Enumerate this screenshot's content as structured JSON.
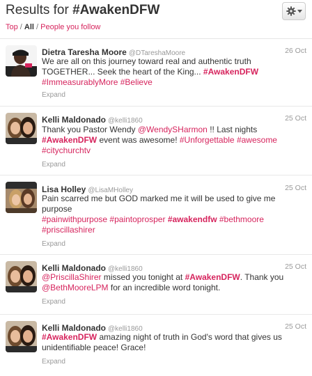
{
  "header": {
    "title_prefix": "Results for ",
    "title_query": "#AwakenDFW",
    "filters": {
      "top": "Top",
      "sep1": " / ",
      "all": "All",
      "sep2": " / ",
      "people": "People you follow"
    }
  },
  "colors": {
    "accent": "#d6245d",
    "text": "#333333",
    "muted": "#999999"
  },
  "icons": {
    "settings": "gear-icon",
    "dropdown": "caret-down-icon"
  },
  "tweets": [
    {
      "name": "Dietra Taresha Moore",
      "handle": "@DTareshaMoore",
      "date": "26 Oct",
      "expand": "Expand",
      "lines": [
        [
          {
            "t": "We are all on this journey toward real and authentic truth"
          }
        ],
        [
          {
            "t": "TOGETHER... Seek the heart of the King... "
          },
          {
            "t": "#AwakenDFW"
          }
        ],
        [
          {
            "t": "#ImmeasurablyMore"
          },
          {
            "t": " "
          },
          {
            "t": "#Believe"
          }
        ]
      ]
    },
    {
      "name": "Kelli Maldonado",
      "handle": "@kelli1860",
      "date": "25 Oct",
      "expand": "Expand",
      "lines": [
        [
          {
            "t": "Thank you Pastor Wendy "
          },
          {
            "t": "@WendySHarmon"
          },
          {
            "t": " !! Last nights"
          }
        ],
        [
          {
            "t": "#AwakenDFW"
          },
          {
            "t": " event was awesome! "
          },
          {
            "t": "#Unforgettable"
          },
          {
            "t": " "
          },
          {
            "t": "#awesome"
          }
        ],
        [
          {
            "t": "#citychurchtv"
          }
        ]
      ]
    },
    {
      "name": "Lisa Holley",
      "handle": "@LisaMHolley",
      "date": "25 Oct",
      "expand": "Expand",
      "lines": [
        [
          {
            "t": "Pain scarred me but GOD marked me it will be used to give me"
          }
        ],
        [
          {
            "t": "purpose"
          }
        ],
        [
          {
            "t": "#painwithpurpose"
          },
          {
            "t": " "
          },
          {
            "t": "#paintoprosper"
          },
          {
            "t": " "
          },
          {
            "t": "#awakendfw"
          },
          {
            "t": " "
          },
          {
            "t": "#bethmoore"
          }
        ],
        [
          {
            "t": "#priscillashirer"
          }
        ]
      ]
    },
    {
      "name": "Kelli Maldonado",
      "handle": "@kelli1860",
      "date": "25 Oct",
      "expand": "Expand",
      "lines": [
        [
          {
            "t": "@PriscillaShirer"
          },
          {
            "t": " missed you tonight at "
          },
          {
            "t": "#AwakenDFW"
          },
          {
            "t": ". Thank you"
          }
        ],
        [
          {
            "t": "@BethMooreLPM"
          },
          {
            "t": " for an incredible word tonight."
          }
        ]
      ]
    },
    {
      "name": "Kelli Maldonado",
      "handle": "@kelli1860",
      "date": "25 Oct",
      "expand": "Expand",
      "lines": [
        [
          {
            "t": "#AwakenDFW"
          },
          {
            "t": " amazing night of truth in God's word that gives us"
          }
        ],
        [
          {
            "t": "unidentifiable peace! Grace!"
          }
        ]
      ]
    }
  ]
}
